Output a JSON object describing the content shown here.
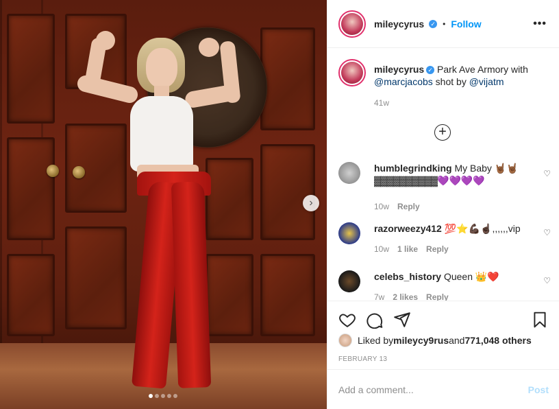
{
  "post": {
    "username": "mileycyrus",
    "verified": true,
    "follow_label": "Follow",
    "more_label": "•••",
    "separator": "•"
  },
  "caption": {
    "username": "mileycyrus",
    "text_1": " Park Ave Armory with",
    "mention_1": "@marcjacobs",
    "text_2": " shot by ",
    "mention_2": "@vijatm",
    "age": "41w"
  },
  "load_more_icon": "plus-circle-icon",
  "comments": [
    {
      "username": "humblegrindking",
      "text": "My Baby 🤘🏾🤘🏾",
      "text_2": "▓▓▓▓▓▓▓▓▓▓",
      "emoji_2": "💜💜💜💜",
      "age": "10w",
      "likes": "",
      "reply": "Reply"
    },
    {
      "username": "razorweezy412",
      "text": "💯⭐💪🏿☝🏿,,,,,,vip",
      "age": "10w",
      "likes": "1 like",
      "reply": "Reply"
    },
    {
      "username": "celebs_history",
      "text": "Queen 👑❤️",
      "age": "7w",
      "likes": "2 likes",
      "reply": "Reply"
    }
  ],
  "actions": {
    "liked_by_prefix": "Liked by ",
    "liked_by_user": "mileycy9rus",
    "and": " and ",
    "others": "771,048 others",
    "date": "FEBRUARY 13"
  },
  "composer": {
    "placeholder": "Add a comment...",
    "post_label": "Post"
  },
  "carousel": {
    "total": 5,
    "active": 1
  },
  "colors": {
    "accent": "#0095f6",
    "verified": "#3897f0",
    "post_disabled": "#b2dffc",
    "muted": "#8e8e8e"
  }
}
